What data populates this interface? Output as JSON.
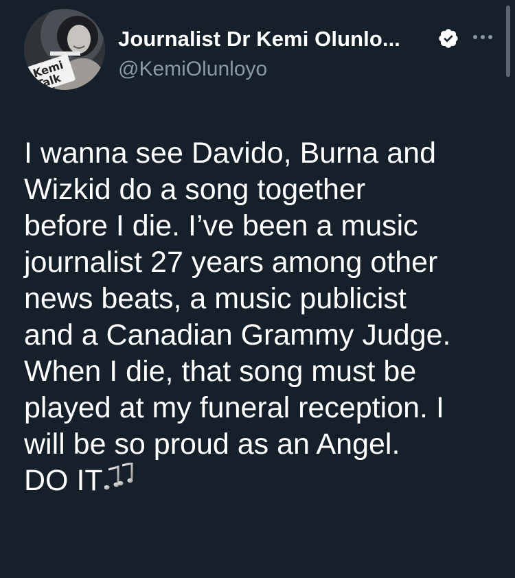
{
  "author": {
    "display_name": "Journalist Dr Kemi Olunlo...",
    "handle": "@KemiOlunloyo",
    "verified": true,
    "avatar_text": {
      "top": "Kemi",
      "bottom": "Talk"
    }
  },
  "tweet": {
    "lines": [
      "I wanna see Davido, Burna and",
      "Wizkid do a song together",
      "before I die. I’ve been a music",
      "journalist 27 years among other",
      "news beats, a music publicist",
      "and a Canadian Grammy Judge.",
      "When I die, that song must be",
      "played at my funeral reception. I",
      "will be so proud as an Angel.",
      "DO IT"
    ],
    "trailing_emoji": "musical-notes"
  },
  "colors": {
    "background": "#15202b",
    "text": "#ffffff",
    "secondary_text": "#8b98a5",
    "verified_badge": "#ffffff"
  },
  "icons": {
    "verified": "verified-badge-icon",
    "more": "more-options-icon",
    "emoji": "musical-notes-icon"
  }
}
